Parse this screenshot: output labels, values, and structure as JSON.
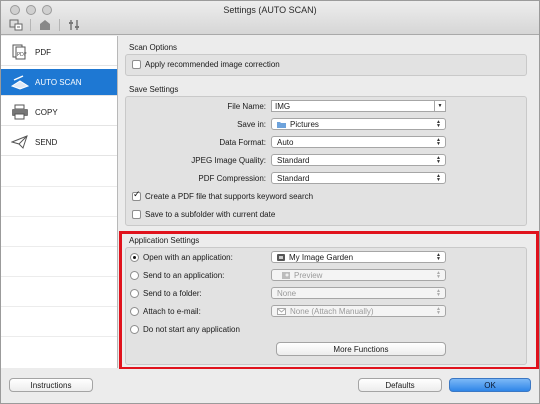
{
  "window": {
    "title": "Settings (AUTO SCAN)"
  },
  "toolbar": {
    "icons": [
      "scan-from-computer-icon",
      "scan-from-operation-panel-icon",
      "general-settings-icon"
    ]
  },
  "sidebar": {
    "items": [
      {
        "label": "PDF",
        "icon": "pdf-document-icon",
        "selected": false
      },
      {
        "label": "AUTO SCAN",
        "icon": "auto-scan-icon",
        "selected": true
      },
      {
        "label": "COPY",
        "icon": "copy-printer-icon",
        "selected": false
      },
      {
        "label": "SEND",
        "icon": "send-plane-icon",
        "selected": false
      }
    ]
  },
  "scan_options": {
    "title": "Scan Options",
    "apply_correction": {
      "label": "Apply recommended image correction",
      "checked": false
    }
  },
  "save_settings": {
    "title": "Save Settings",
    "file_name": {
      "label": "File Name:",
      "value": "IMG"
    },
    "save_in": {
      "label": "Save in:",
      "value": "Pictures",
      "icon": "folder-icon"
    },
    "data_format": {
      "label": "Data Format:",
      "value": "Auto"
    },
    "jpeg_quality": {
      "label": "JPEG Image Quality:",
      "value": "Standard"
    },
    "pdf_compression": {
      "label": "PDF Compression:",
      "value": "Standard"
    },
    "keyword_pdf": {
      "label": "Create a PDF file that supports keyword search",
      "checked": true
    },
    "subfolder": {
      "label": "Save to a subfolder with current date",
      "checked": false
    }
  },
  "application_settings": {
    "title": "Application Settings",
    "open_app": {
      "label": "Open with an application:",
      "value": "My Image Garden",
      "selected": true,
      "icon": "my-image-garden-icon"
    },
    "send_app": {
      "label": "Send to an application:",
      "value": "Preview",
      "selected": false,
      "icon": "preview-app-icon"
    },
    "send_folder": {
      "label": "Send to a folder:",
      "value": "None",
      "selected": false
    },
    "attach_email": {
      "label": "Attach to e-mail:",
      "value": "None (Attach Manually)",
      "selected": false,
      "icon": "mail-icon"
    },
    "no_app": {
      "label": "Do not start any application",
      "selected": false
    },
    "more_functions": "More Functions"
  },
  "footer": {
    "instructions": "Instructions",
    "defaults": "Defaults",
    "ok": "OK"
  },
  "colors": {
    "selection": "#1e78d3",
    "highlight_frame": "#e0121c",
    "ok_button": "#2f86e8"
  }
}
